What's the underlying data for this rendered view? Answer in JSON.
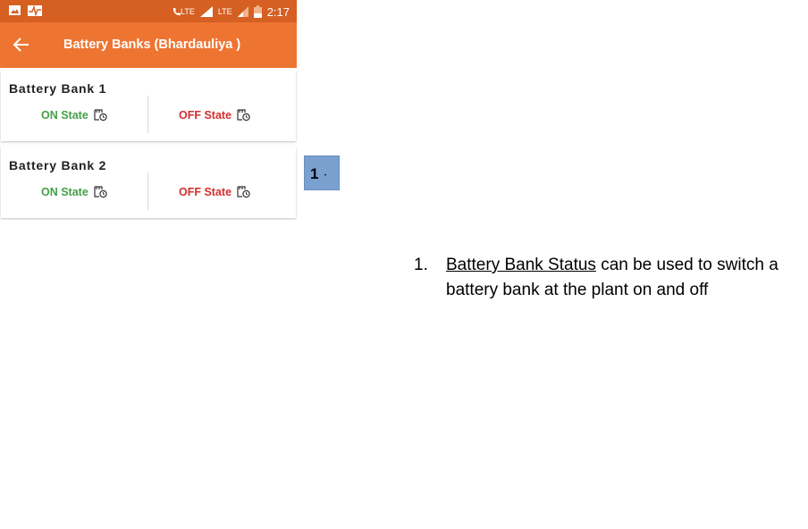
{
  "statusbar": {
    "time": "2:17",
    "network1": "LTE",
    "network2": "LTE"
  },
  "appbar": {
    "title": "Battery Banks (Bhardauliya )"
  },
  "banks": [
    {
      "title": "Battery Bank 1",
      "on_label": "ON State",
      "off_label": "OFF State"
    },
    {
      "title": "Battery Bank 2",
      "on_label": "ON State",
      "off_label": "OFF State"
    }
  ],
  "colors": {
    "statusbar": "#d65f22",
    "appbar": "#ee7432",
    "on": "#43a047",
    "off": "#d32f2f",
    "marker": "#7aa0cf"
  },
  "annotation": {
    "marker_label": "1",
    "marker_dot": "•",
    "note_number": "1.",
    "note_link": "Battery Bank Status",
    "note_text": " can be used to switch a battery bank at the plant on and off"
  }
}
